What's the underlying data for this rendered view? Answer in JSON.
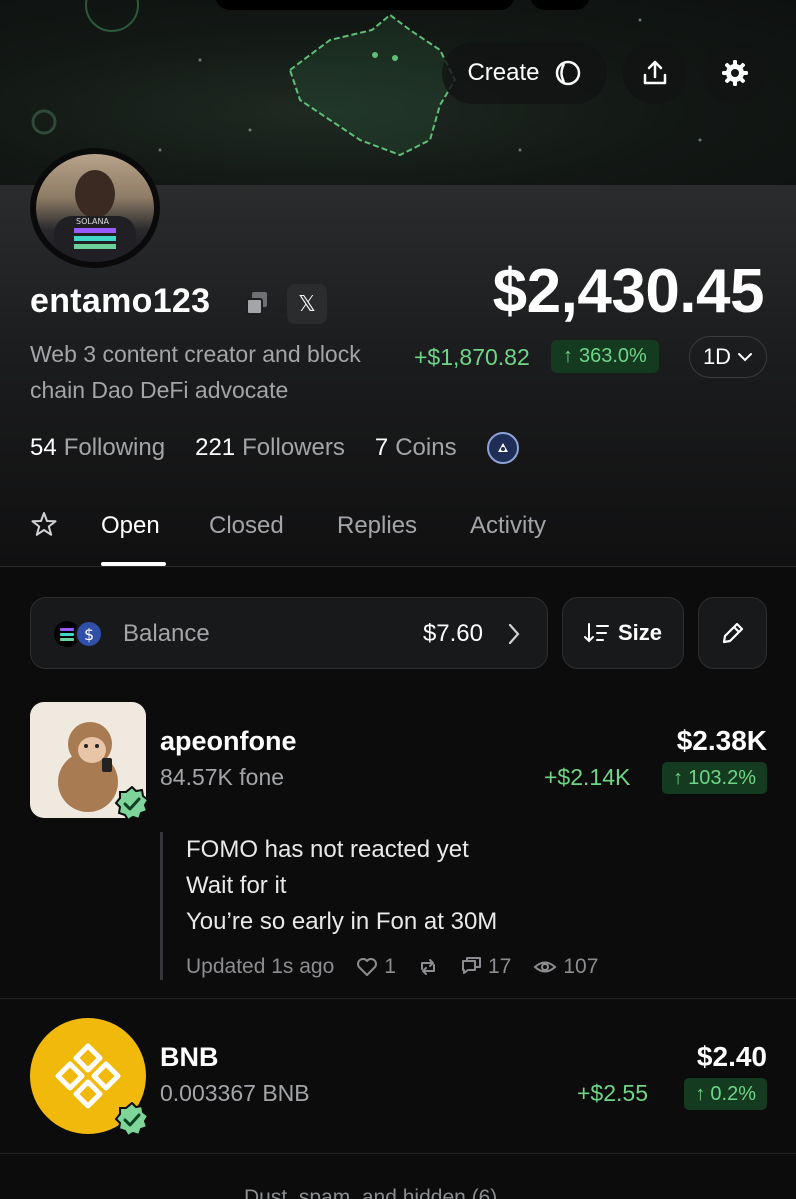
{
  "header": {
    "create_label": "Create",
    "icons": [
      "create-coin-icon",
      "share-icon",
      "settings-gear-icon"
    ]
  },
  "profile": {
    "username": "entamo123",
    "bio": "Web 3 content creator and block chain Dao DeFi advocate",
    "x_badge": "𝕏",
    "stats": {
      "following_count": "54",
      "following_label": "Following",
      "followers_count": "221",
      "followers_label": "Followers",
      "coins_count": "7",
      "coins_label": "Coins"
    }
  },
  "portfolio": {
    "total_value": "$2,430.45",
    "change_amount": "+$1,870.82",
    "change_percent": "363.0%",
    "period": "1D"
  },
  "tabs": [
    "Open",
    "Closed",
    "Replies",
    "Activity"
  ],
  "active_tab": "Open",
  "toolbar": {
    "balance_label": "Balance",
    "balance_value": "$7.60",
    "sort_label": "Size"
  },
  "holdings": [
    {
      "name": "apeonfone",
      "amount": "84.57K fone",
      "value": "$2.38K",
      "gain": "+$2.14K",
      "gain_pct": "103.2%",
      "post": {
        "lines": [
          "FOMO has not reacted yet",
          "Wait for it",
          "You’re so early in Fon at 30M"
        ],
        "updated": "Updated 1s ago",
        "likes": "1",
        "replies": "17",
        "views": "107"
      }
    },
    {
      "name": "BNB",
      "amount": "0.003367 BNB",
      "value": "$2.40",
      "gain": "+$2.55",
      "gain_pct": "0.2%"
    }
  ],
  "footer_text": "Dust, spam, and hidden (6)",
  "colors": {
    "background": "#0c0c0d",
    "positive": "#6fd587",
    "positive_bg": "#143a20",
    "muted": "#a3a5a8",
    "bnb_yellow": "#f0b90b"
  }
}
